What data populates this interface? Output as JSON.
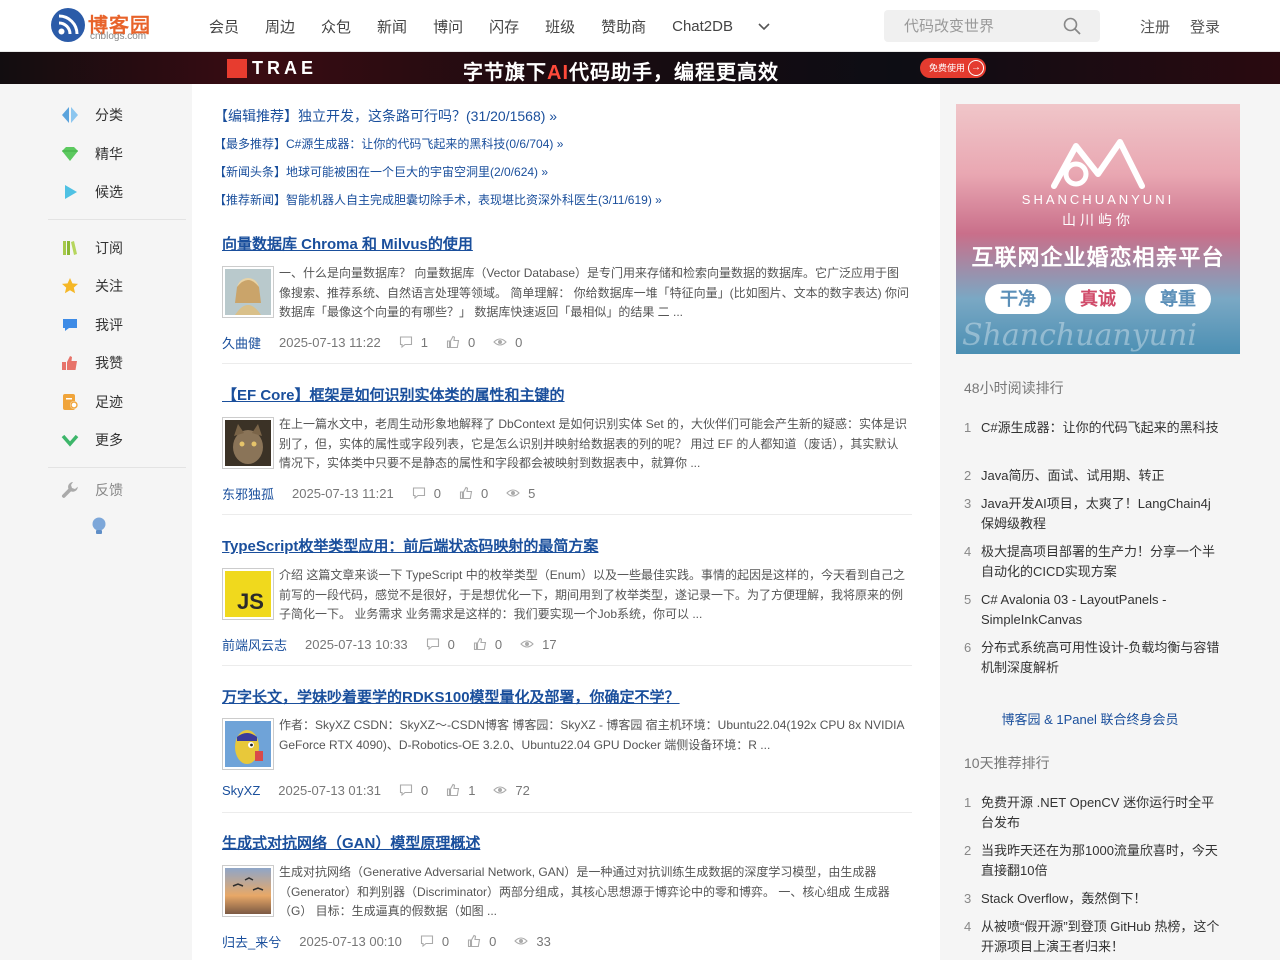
{
  "header": {
    "logo_cn": "博客园",
    "logo_en": "cnblogs.com",
    "nav": [
      "会员",
      "周边",
      "众包",
      "新闻",
      "博问",
      "闪存",
      "班级",
      "赞助商",
      "Chat2DB"
    ],
    "search_placeholder": "代码改变世界",
    "register": "注册",
    "login": "登录"
  },
  "banner": {
    "brand": "TRAE",
    "slogan_prefix": "字节旗下",
    "slogan_highlight": "AI",
    "slogan_suffix": "代码助手，编程更高效",
    "cta": "免费使用"
  },
  "left_sidebar": {
    "group1": [
      {
        "label": "分类",
        "icon": "category-icon"
      },
      {
        "label": "精华",
        "icon": "gem-icon"
      },
      {
        "label": "候选",
        "icon": "play-icon"
      }
    ],
    "group2": [
      {
        "label": "订阅",
        "icon": "books-icon"
      },
      {
        "label": "关注",
        "icon": "star-icon"
      },
      {
        "label": "我评",
        "icon": "comment-icon"
      },
      {
        "label": "我赞",
        "icon": "thumbs-up-icon"
      },
      {
        "label": "足迹",
        "icon": "footprint-icon"
      },
      {
        "label": "更多",
        "icon": "chevron-down-icon"
      }
    ],
    "feedback": "反馈"
  },
  "top_links": [
    "【编辑推荐】独立开发，这条路可行吗？(31/20/1568) »",
    "【最多推荐】C#源生成器：让你的代码飞起来的黑科技(0/6/704) »",
    "【新闻头条】地球可能被困在一个巨大的宇宙空洞里(2/0/624) »",
    "【推荐新闻】智能机器人自主完成胆囊切除手术，表现堪比资深外科医生(3/11/619) »"
  ],
  "posts": [
    {
      "title": "向量数据库 Chroma 和 Milvus的使用",
      "summary": "一、什么是向量数据库？ 向量数据库（Vector Database）是专门用来存储和检索向量数据的数据库。它广泛应用于图像搜索、推荐系统、自然语言处理等领域。 简单理解： 你给数据库一堆「特征向量」(比如图片、文本的数字表达) 你问数据库「最像这个向量的有哪些？」 数据库快速返回「最相似」的结果 二 ...",
      "author": "久曲健",
      "date": "2025-07-13 11:22",
      "comments": "1",
      "likes": "0",
      "views": "0"
    },
    {
      "title": "【EF Core】框架是如何识别实体类的属性和主键的",
      "summary": "在上一篇水文中，老周生动形象地解释了 DbContext 是如何识别实体 Set 的，大伙伴们可能会产生新的疑惑：实体是识别了，但，实体的属性或字段列表，它是怎么识别并映射给数据表的列的呢？ 用过 EF 的人都知道（废话），其实默认情况下，实体类中只要不是静态的属性和字段都会被映射到数据表中，就算你 ...",
      "author": "东邪独孤",
      "date": "2025-07-13 11:21",
      "comments": "0",
      "likes": "0",
      "views": "5"
    },
    {
      "title": "TypeScript枚举类型应用：前后端状态码映射的最简方案",
      "summary": "介绍 这篇文章来谈一下 TypeScript 中的枚举类型（Enum）以及一些最佳实践。事情的起因是这样的，今天看到自己之前写的一段代码，感觉不是很好，于是想优化一下，期间用到了枚举类型，遂记录一下。为了方便理解，我将原来的例子简化一下。 业务需求 业务需求是这样的：我们要实现一个Job系统，你可以 ...",
      "author": "前端风云志",
      "date": "2025-07-13 10:33",
      "comments": "0",
      "likes": "0",
      "views": "17"
    },
    {
      "title": "万字长文，学妹吵着要学的RDKS100模型量化及部署，你确定不学？",
      "summary": "作者：SkyXZ CSDN：SkyXZ～-CSDN博客 博客园：SkyXZ - 博客园 宿主机环境：Ubuntu22.04(192x CPU 8x NVIDIA GeForce RTX 4090)、D-Robotics-OE 3.2.0、Ubuntu22.04 GPU Docker 端侧设备环境：R ...",
      "author": "SkyXZ",
      "date": "2025-07-13 01:31",
      "comments": "0",
      "likes": "1",
      "views": "72"
    },
    {
      "title": "生成式对抗网络（GAN）模型原理概述",
      "summary": "生成对抗网络（Generative Adversarial Network, GAN）是一种通过对抗训练生成数据的深度学习模型，由生成器（Generator）和判别器（Discriminator）两部分组成，其核心思想源于博弈论中的零和博弈。 一、核心组成 生成器（G） 目标：生成逼真的假数据（如图 ...",
      "author": "归去_来兮",
      "date": "2025-07-13 00:10",
      "comments": "0",
      "likes": "0",
      "views": "33"
    }
  ],
  "right_sidebar": {
    "ad": {
      "brand_en": "SHANCHUANYUNI",
      "brand_cn": "山川屿你",
      "headline": "互联网企业婚恋相亲平台",
      "pills": [
        "干净",
        "真诚",
        "尊重"
      ],
      "watermark": "Shanchuanyuni"
    },
    "reading_rank_title": "48小时阅读排行",
    "reading_rank": [
      "C#源生成器：让你的代码飞起来的黑科技",
      "Java简历、面试、试用期、转正",
      "Java开发AI项目，太爽了！LangChain4j保姆级教程",
      "极大提高项目部署的生产力！分享一个半自动化的CICD实现方案",
      "C# Avalonia 03 - LayoutPanels - SimpleInkCanvas",
      "分布式系统高可用性设计-负载均衡与容错机制深度解析"
    ],
    "promo": "博客园 & 1Panel 联合终身会员",
    "recommend_rank_title": "10天推荐排行",
    "recommend_rank": [
      "免费开源 .NET OpenCV 迷你运行时全平台发布",
      "当我昨天还在为那1000流量欣喜时，今天直接翻10倍",
      "Stack Overflow，轰然倒下！",
      "从被喷“假开源”到登顶 GitHub 热榜，这个开源项目上演王者归来！"
    ]
  },
  "colors": {
    "link": "#1a4f9c",
    "brand_orange": "#e8632a",
    "banner_red": "#e43b2f"
  }
}
